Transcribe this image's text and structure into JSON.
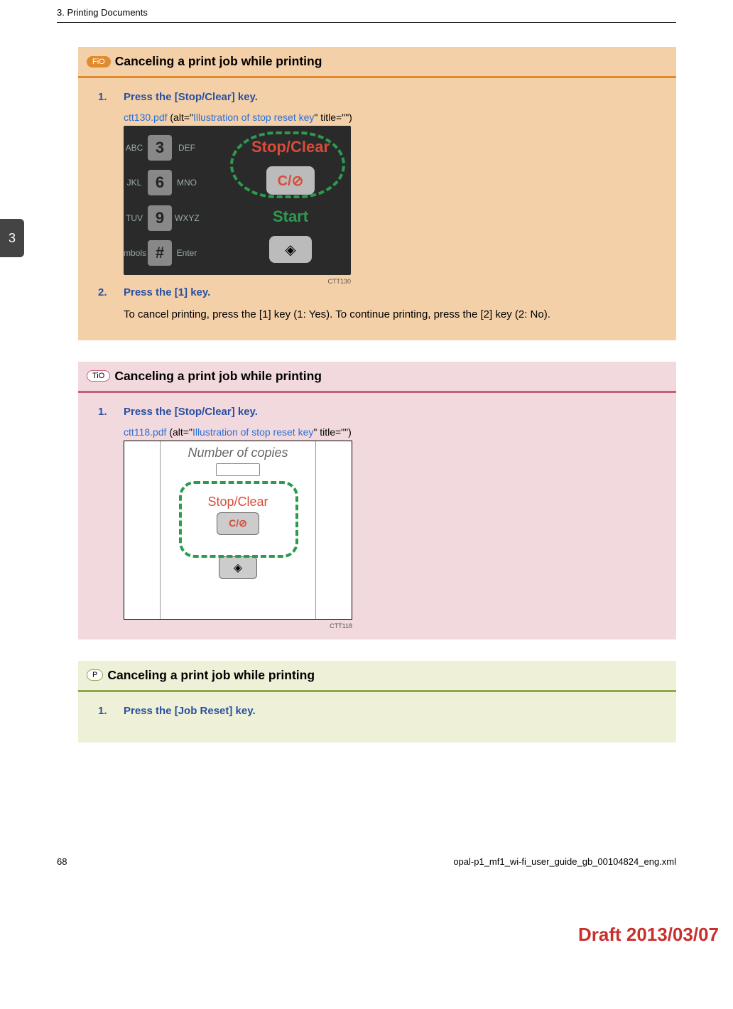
{
  "header": {
    "chapter": "3. Printing Documents"
  },
  "tab": {
    "number": "3"
  },
  "sections": {
    "fio": {
      "tag": "FiO",
      "title": "Canceling a print job while printing",
      "steps": [
        {
          "title": "Press the [Stop/Clear] key.",
          "link_file": "ctt130.pdf",
          "link_alt": "Illustration of stop reset key",
          "link_prefix": " (alt=\"",
          "link_suffix": "\" title=\"\")",
          "fig_code": "CTT130"
        },
        {
          "title": "Press the [1] key.",
          "desc": "To cancel printing, press the [1] key (1: Yes). To continue printing, press the [2] key (2: No)."
        }
      ],
      "keypad": {
        "rows": [
          {
            "left": "ABC",
            "num": "3",
            "right": "DEF"
          },
          {
            "left": "JKL",
            "num": "6",
            "right": "MNO"
          },
          {
            "left": "TUV",
            "num": "9",
            "right": "WXYZ"
          },
          {
            "left": "mbols",
            "num": "#",
            "right": "Enter"
          }
        ],
        "stopclear": "Stop/Clear",
        "stopclear_btn": "C/⊘",
        "start": "Start",
        "start_btn": "◈"
      }
    },
    "tio": {
      "tag": "TiO",
      "title": "Canceling a print job while printing",
      "steps": [
        {
          "title": "Press the [Stop/Clear] key.",
          "link_file": "ctt118.pdf",
          "link_alt": "Illustration of stop reset key",
          "link_prefix": " (alt=\"",
          "link_suffix": "\" title=\"\")",
          "fig_code": "CTT118"
        }
      ],
      "panel": {
        "noc": "Number of copies",
        "stopclear": "Stop/Clear",
        "stopclear_btn": "C/⊘",
        "start_btn": "◈"
      }
    },
    "p": {
      "tag": "P",
      "title": "Canceling a print job while printing",
      "steps": [
        {
          "title": "Press the [Job Reset] key."
        }
      ]
    }
  },
  "footer": {
    "page": "68",
    "file": "opal-p1_mf1_wi-fi_user_guide_gb_00104824_eng.xml"
  },
  "draft": "Draft 2013/03/07"
}
